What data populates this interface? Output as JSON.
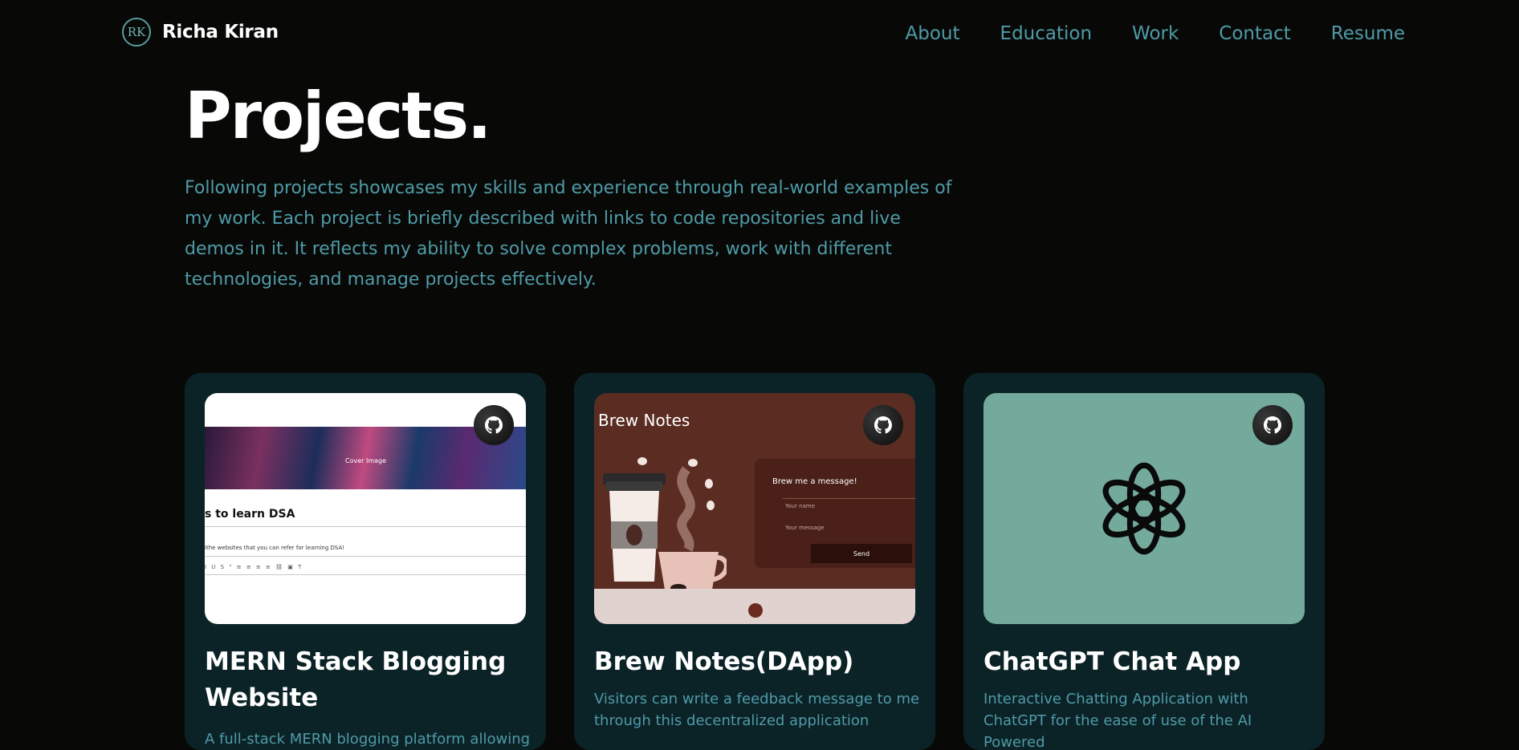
{
  "brand": {
    "initials": "RK",
    "name": "Richa Kiran"
  },
  "nav": {
    "links": [
      "About",
      "Education",
      "Work",
      "Contact",
      "Resume"
    ]
  },
  "section": {
    "title": "Projects.",
    "intro": "Following projects showcases my skills and experience through real-world examples of my work. Each project is briefly described with links to code repositories and live demos in it. It reflects my ability to solve complex problems, work with different technologies, and manage projects effectively."
  },
  "projects": [
    {
      "title": "MERN Stack Blogging Website",
      "description": "A full-stack MERN blogging platform allowing",
      "thumb": {
        "cover_label": "Cover Image",
        "post_title": "s to learn DSA",
        "post_desc": "ithe websites that you can refer for learning DSA!",
        "toolbar": "I U S \" ≡ ≡ ≡ ≡ ⛓ ▣ T"
      }
    },
    {
      "title": "Brew Notes(DApp)",
      "description": "Visitors can write a feedback message to me through this decentralized application",
      "thumb": {
        "app_title": "Brew Notes",
        "form_title": "Brew me a message!",
        "name_placeholder": "Your name",
        "message_placeholder": "Your message",
        "send_label": "Send"
      }
    },
    {
      "title": "ChatGPT Chat App",
      "description": "Interactive Chatting Application with ChatGPT for the ease of use of the AI Powered"
    }
  ],
  "colors": {
    "background": "#080906",
    "accent": "#4f9aa8",
    "card": "#0b2327",
    "chatgpt_thumb": "#74aa9c",
    "brew_thumb": "#5a2c22"
  },
  "icons": [
    "github-icon",
    "openai-logo-icon",
    "coffee-cup-icon"
  ]
}
